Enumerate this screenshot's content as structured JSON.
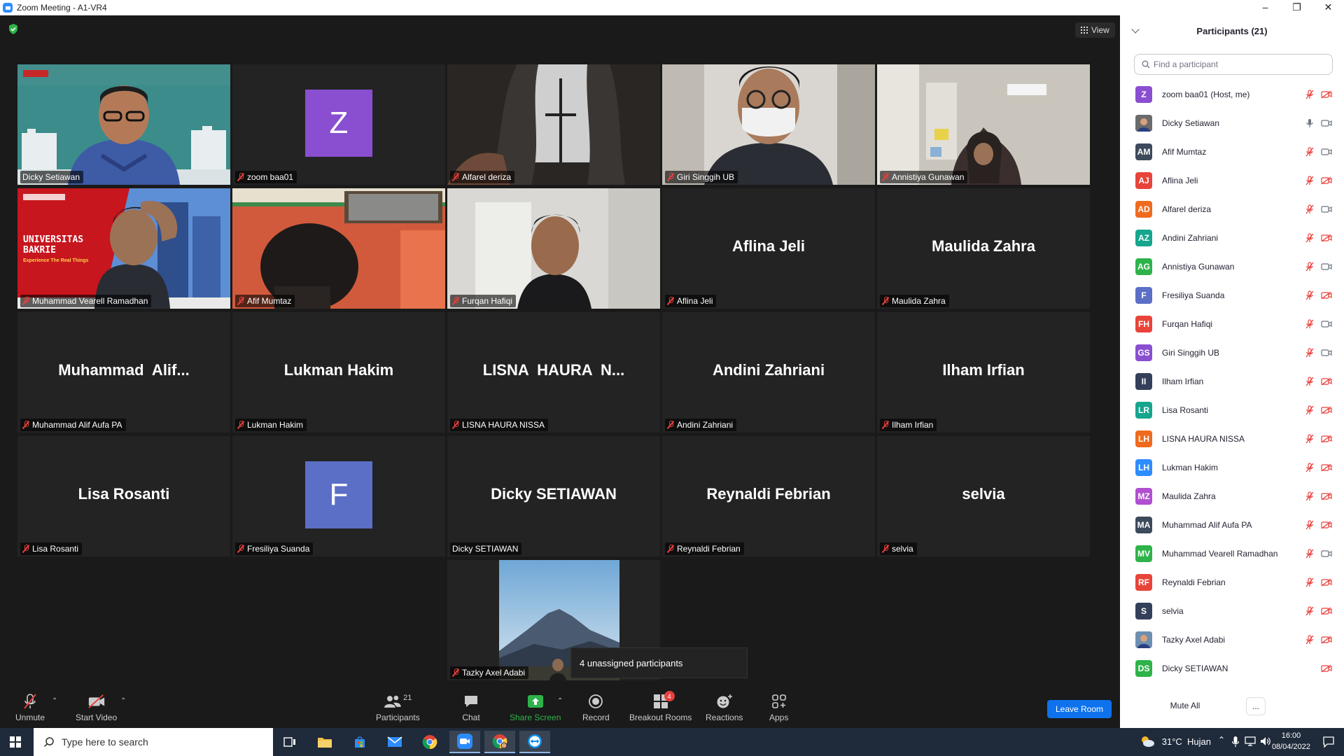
{
  "window": {
    "title": "Zoom Meeting - A1-VR4"
  },
  "meeting": {
    "view_label": "View",
    "tooltip": "4 unassigned participants",
    "tiles": [
      {
        "label": "Dicky Setiawan",
        "muted": false,
        "kind": "video",
        "active": true
      },
      {
        "label": "zoom baa01",
        "muted": true,
        "kind": "avatar",
        "letter": "Z",
        "color": "#8a4fd0"
      },
      {
        "label": "Alfarel deriza",
        "muted": true,
        "kind": "video"
      },
      {
        "label": "Giri Singgih UB",
        "muted": true,
        "kind": "video"
      },
      {
        "label": "Annistiya Gunawan",
        "muted": true,
        "kind": "video"
      },
      {
        "label": "Muhammad Vearell Ramadhan",
        "muted": true,
        "kind": "video",
        "banner_title": "UNIVERSITAS\nBAKRIE",
        "banner_sub": "Experience The Real Things"
      },
      {
        "label": "Afif Mumtaz",
        "muted": true,
        "kind": "video"
      },
      {
        "label": "Furqan Hafiqi",
        "muted": true,
        "kind": "video"
      },
      {
        "label": "Aflina Jeli",
        "muted": true,
        "kind": "name",
        "bigname": "Aflina Jeli"
      },
      {
        "label": "Maulida Zahra",
        "muted": true,
        "kind": "name",
        "bigname": "Maulida Zahra"
      },
      {
        "label": "Muhammad Alif Aufa PA",
        "muted": true,
        "kind": "name",
        "bigname": "Muhammad  Alif..."
      },
      {
        "label": "Lukman Hakim",
        "muted": true,
        "kind": "name",
        "bigname": "Lukman Hakim"
      },
      {
        "label": "LISNA HAURA NISSA",
        "muted": true,
        "kind": "name",
        "bigname": "LISNA  HAURA  N..."
      },
      {
        "label": "Andini Zahriani",
        "muted": true,
        "kind": "name",
        "bigname": "Andini Zahriani"
      },
      {
        "label": "Ilham Irfian",
        "muted": true,
        "kind": "name",
        "bigname": "Ilham Irfian"
      },
      {
        "label": "Lisa Rosanti",
        "muted": true,
        "kind": "name",
        "bigname": "Lisa Rosanti"
      },
      {
        "label": "Fresiliya Suanda",
        "muted": true,
        "kind": "avatar",
        "letter": "F",
        "color": "#5b6fc7"
      },
      {
        "label": "Dicky SETIAWAN",
        "muted": false,
        "kind": "name",
        "bigname": "Dicky SETIAWAN"
      },
      {
        "label": "Reynaldi Febrian",
        "muted": true,
        "kind": "name",
        "bigname": "Reynaldi Febrian"
      },
      {
        "label": "selvia",
        "muted": true,
        "kind": "name",
        "bigname": "selvia"
      },
      {
        "label": "Tazky Axel Adabi",
        "muted": true,
        "kind": "photo"
      }
    ]
  },
  "toolbar": {
    "unmute": "Unmute",
    "start_video": "Start Video",
    "participants": "Participants",
    "participants_count": "21",
    "chat": "Chat",
    "share_screen": "Share Screen",
    "record": "Record",
    "breakout_rooms": "Breakout Rooms",
    "breakout_badge": "4",
    "reactions": "Reactions",
    "apps": "Apps",
    "leave_room": "Leave Room"
  },
  "panel": {
    "title": "Participants (21)",
    "search_placeholder": "Find a participant",
    "mute_all": "Mute All",
    "more": "...",
    "participants": [
      {
        "initials": "Z",
        "name": "zoom baa01 (Host, me)",
        "color": "#8a4fd0",
        "mic": "off",
        "cam": "off"
      },
      {
        "initials": "",
        "name": "Dicky Setiawan",
        "color": "#6b6b6b",
        "mic": "on",
        "cam": "on",
        "photo": true
      },
      {
        "initials": "AM",
        "name": "Afif Mumtaz",
        "color": "#3d4a5c",
        "mic": "off",
        "cam": "on"
      },
      {
        "initials": "AJ",
        "name": "Aflina Jeli",
        "color": "#e8443a",
        "mic": "off",
        "cam": "off"
      },
      {
        "initials": "AD",
        "name": "Alfarel deriza",
        "color": "#f06a1e",
        "mic": "off",
        "cam": "on"
      },
      {
        "initials": "AZ",
        "name": "Andini Zahriani",
        "color": "#16a58d",
        "mic": "off",
        "cam": "off"
      },
      {
        "initials": "AG",
        "name": "Annistiya Gunawan",
        "color": "#2eb34a",
        "mic": "off",
        "cam": "on"
      },
      {
        "initials": "F",
        "name": "Fresiliya Suanda",
        "color": "#5b6fc7",
        "mic": "off",
        "cam": "off"
      },
      {
        "initials": "FH",
        "name": "Furqan Hafiqi",
        "color": "#e8443a",
        "mic": "off",
        "cam": "on"
      },
      {
        "initials": "GS",
        "name": "Giri Singgih UB",
        "color": "#8a4fd0",
        "mic": "off",
        "cam": "on"
      },
      {
        "initials": "II",
        "name": "Ilham Irfian",
        "color": "#34405a",
        "mic": "off",
        "cam": "off"
      },
      {
        "initials": "LR",
        "name": "Lisa Rosanti",
        "color": "#16a58d",
        "mic": "off",
        "cam": "off"
      },
      {
        "initials": "LH",
        "name": "LISNA HAURA NISSA",
        "color": "#f06a1e",
        "mic": "off",
        "cam": "off"
      },
      {
        "initials": "LH",
        "name": "Lukman Hakim",
        "color": "#2d8cff",
        "mic": "off",
        "cam": "off"
      },
      {
        "initials": "MZ",
        "name": "Maulida Zahra",
        "color": "#b04fd0",
        "mic": "off",
        "cam": "off"
      },
      {
        "initials": "MA",
        "name": "Muhammad Alif Aufa PA",
        "color": "#3d4a5c",
        "mic": "off",
        "cam": "off"
      },
      {
        "initials": "MV",
        "name": "Muhammad Vearell Ramadhan",
        "color": "#2eb34a",
        "mic": "off",
        "cam": "on"
      },
      {
        "initials": "RF",
        "name": "Reynaldi Febrian",
        "color": "#e8443a",
        "mic": "off",
        "cam": "off"
      },
      {
        "initials": "S",
        "name": "selvia",
        "color": "#34405a",
        "mic": "off",
        "cam": "off"
      },
      {
        "initials": "",
        "name": "Tazky Axel Adabi",
        "color": "#6d8fb0",
        "mic": "off",
        "cam": "off",
        "photo": true
      },
      {
        "initials": "DS",
        "name": "Dicky SETIAWAN",
        "color": "#2eb34a",
        "mic": "none",
        "cam": "off"
      }
    ]
  },
  "taskbar": {
    "search_placeholder": "Type here to search",
    "weather": "31°C  Hujan",
    "time": "16:00",
    "date": "08/04/2022"
  }
}
